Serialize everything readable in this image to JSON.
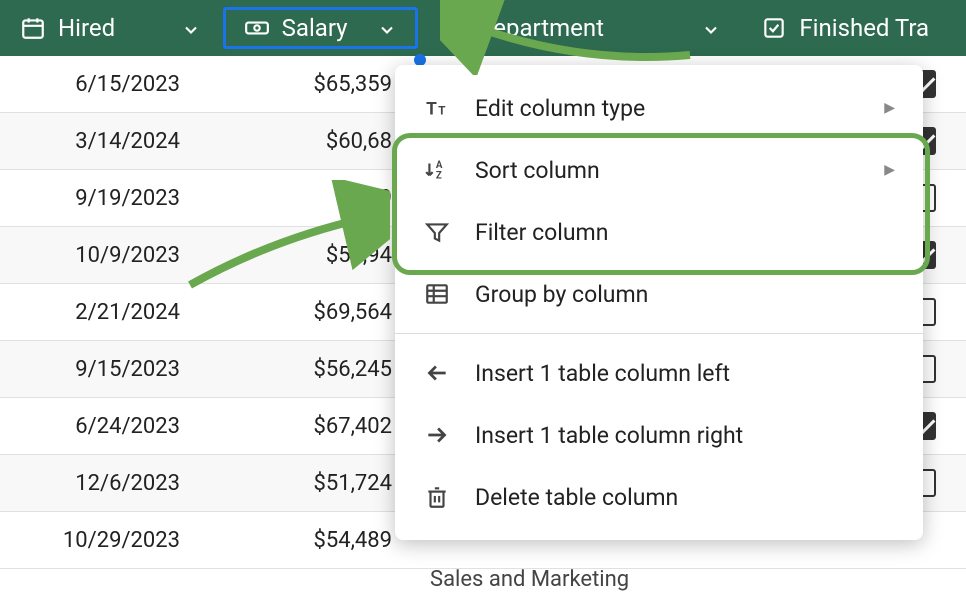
{
  "columns": {
    "hired": {
      "label": "Hired"
    },
    "salary": {
      "label": "Salary"
    },
    "department": {
      "label": "Department"
    },
    "finished": {
      "label": "Finished Tra"
    }
  },
  "rows": [
    {
      "hired": "6/15/2023",
      "salary": "$65,359",
      "checked": true
    },
    {
      "hired": "3/14/2024",
      "salary": "$60,68",
      "checked": true
    },
    {
      "hired": "9/19/2023",
      "salary": "$59",
      "checked": false
    },
    {
      "hired": "10/9/2023",
      "salary": "$58,94",
      "checked": true
    },
    {
      "hired": "2/21/2024",
      "salary": "$69,564",
      "checked": false
    },
    {
      "hired": "9/15/2023",
      "salary": "$56,245",
      "checked": false
    },
    {
      "hired": "6/24/2023",
      "salary": "$67,402",
      "checked": true
    },
    {
      "hired": "12/6/2023",
      "salary": "$51,724",
      "checked": false
    },
    {
      "hired": "10/29/2023",
      "salary": "$54,489",
      "checked": false
    }
  ],
  "menu": {
    "editType": "Edit column type",
    "sort": "Sort column",
    "filter": "Filter column",
    "groupBy": "Group by column",
    "insertLeft": "Insert 1 table column left",
    "insertRight": "Insert 1 table column right",
    "delete": "Delete table column"
  },
  "footer_text": "Sales and Marketing",
  "colors": {
    "headerBg": "#2d6a4f",
    "highlight": "#6aa84f",
    "selectedBorder": "#1a73e8"
  }
}
